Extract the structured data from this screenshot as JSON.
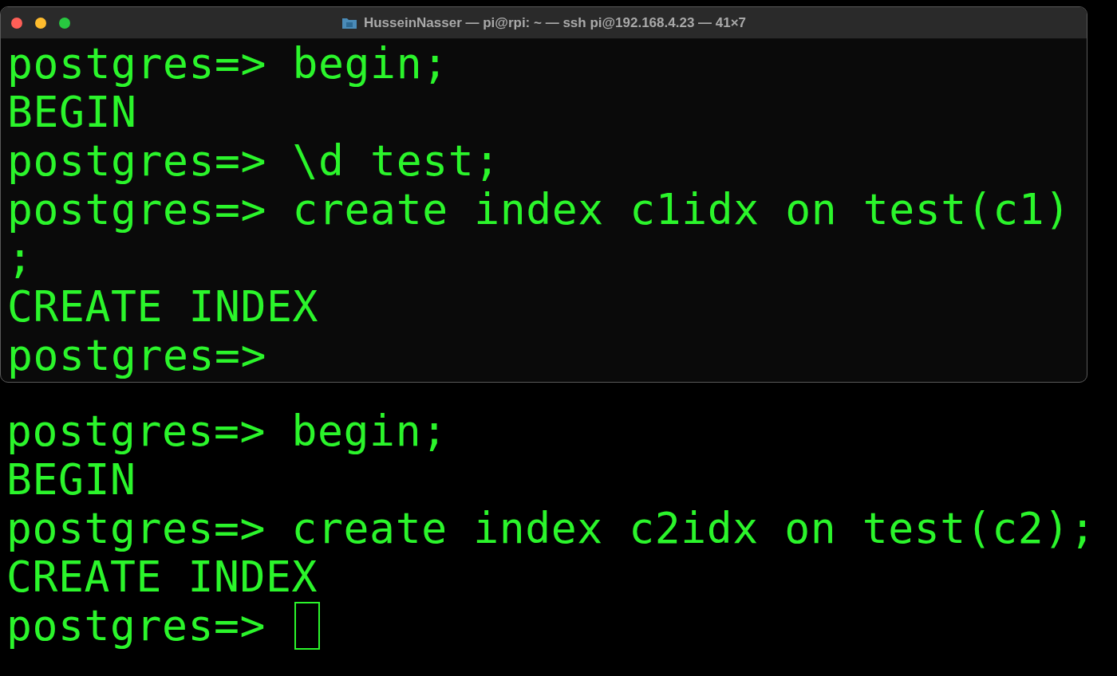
{
  "window": {
    "title": "HusseinNasser — pi@rpi: ~ — ssh pi@192.168.4.23 — 41×7",
    "lines": [
      "postgres=> begin;",
      "BEGIN",
      "postgres=> \\d test;",
      "postgres=> create index c1idx on test(c1)",
      ";",
      "CREATE INDEX",
      "postgres=>"
    ]
  },
  "background_terminal": {
    "lines": [
      "postgres=> begin;",
      "BEGIN",
      "postgres=> create index c2idx on test(c2);",
      "CREATE INDEX",
      "postgres=>"
    ],
    "cursor_visible": true
  }
}
